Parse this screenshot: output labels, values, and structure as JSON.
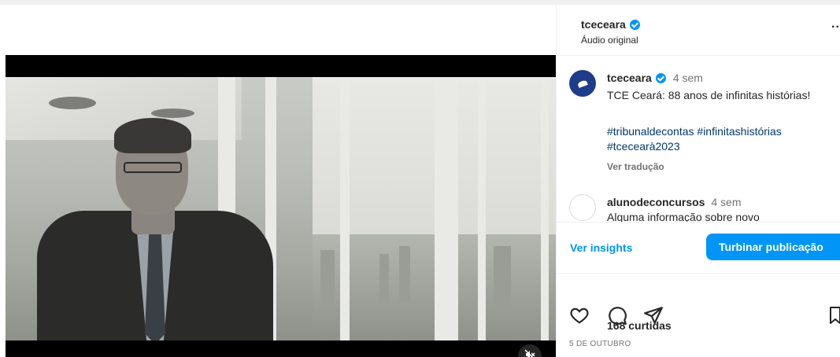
{
  "post": {
    "username": "tceceara",
    "audio": "Áudio original",
    "more": "..",
    "caption": {
      "username": "tceceara",
      "time": "4 sem",
      "text": "TCE Ceará: 88 anos de infinitas histórias!",
      "hashtags": "#tribunaldecontas #infinitashistórias #tcecearà2023",
      "translate": "Ver tradução"
    },
    "comment": {
      "username": "alunodeconcursos",
      "time": "4 sem",
      "text": "Alguma informação sobre novo"
    },
    "insights_label": "Ver insights",
    "boost_label": "Turbinar publicação",
    "likes": "168 curtidas",
    "date": "5 DE OUTUBRO"
  },
  "icons": [
    "heart-icon",
    "comment-icon",
    "share-icon",
    "save-icon",
    "mute-icon",
    "verified-icon"
  ],
  "colors": {
    "accent": "#0095f6",
    "hashtag": "#00376b",
    "avatar": "#1f3c8a"
  }
}
